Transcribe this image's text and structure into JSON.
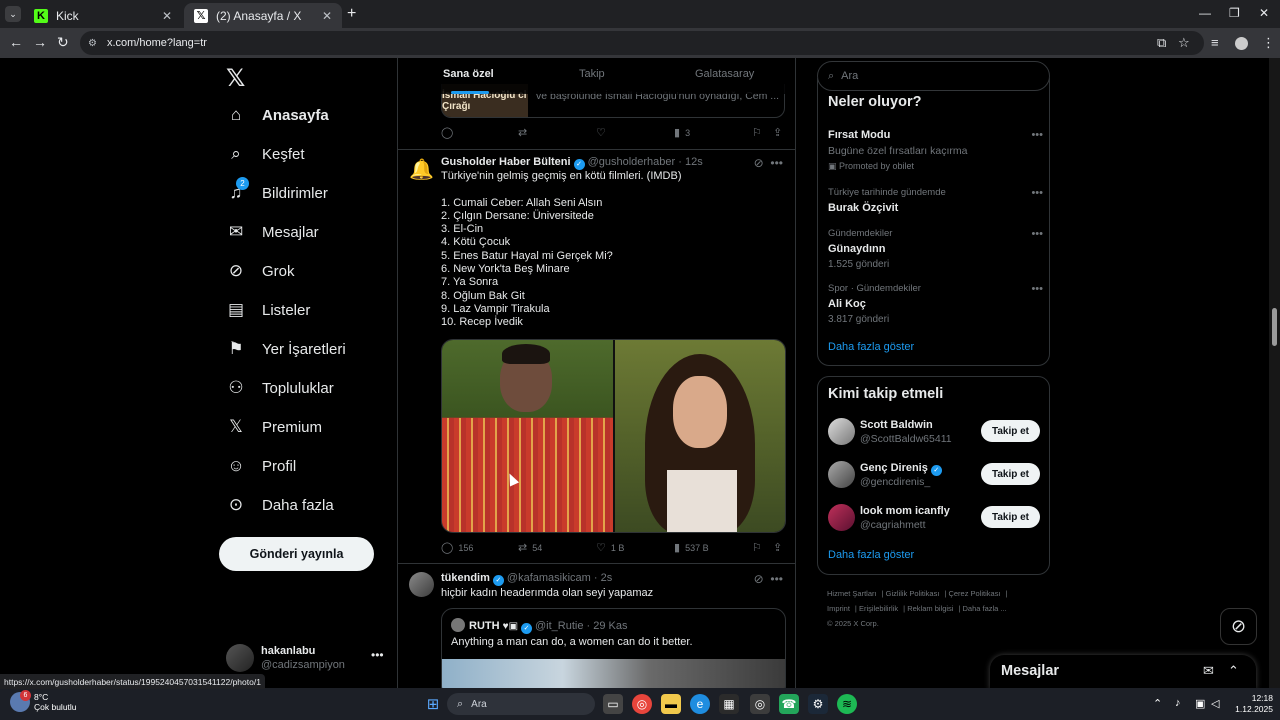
{
  "browser": {
    "tabs": [
      {
        "title": "Kick",
        "favicon": "K",
        "color": "#53fc18"
      },
      {
        "title": "(2) Anasayfa / X",
        "favicon": "X",
        "color": "#000000"
      }
    ],
    "url": "x.com/home?lang=tr",
    "status_url": "https://x.com/gusholderhaber/status/1995240457031541122/photo/1"
  },
  "nav": {
    "items": [
      {
        "label": "Anasayfa",
        "icon": "home-icon"
      },
      {
        "label": "Keşfet",
        "icon": "search-icon"
      },
      {
        "label": "Bildirimler",
        "icon": "bell-icon",
        "badge": "2"
      },
      {
        "label": "Mesajlar",
        "icon": "mail-icon"
      },
      {
        "label": "Grok",
        "icon": "grok-icon"
      },
      {
        "label": "Listeler",
        "icon": "list-icon"
      },
      {
        "label": "Yer İşaretleri",
        "icon": "bookmark-icon"
      },
      {
        "label": "Topluluklar",
        "icon": "communities-icon"
      },
      {
        "label": "Premium",
        "icon": "x-premium-icon"
      },
      {
        "label": "Profil",
        "icon": "profile-icon"
      },
      {
        "label": "Daha fazla",
        "icon": "more-circle-icon"
      }
    ],
    "post_button": "Gönderi yayınla",
    "account": {
      "name": "hakanlabu",
      "handle": "@cadizsampiyon"
    }
  },
  "feed": {
    "tabs": [
      "Sana özel",
      "Takip",
      "Galatasaray"
    ],
    "prev_tweet": {
      "quote_thumb": "İsmail Hacıoğlu ci Çırağı",
      "quote_text": "ve başrolünde İsmail Hacıoğlu'nun oynadığı, Cem ...",
      "views": "3"
    },
    "tweet1": {
      "name": "Gusholder Haber Bülteni",
      "handle": "@gusholderhaber",
      "time": "· 12s",
      "text": "Türkiye'nin gelmiş geçmiş en kötü filmleri. (IMDB)\n\n1. Cumali Ceber: Allah Seni Alsın\n2. Çılgın Dersane: Üniversitede\n3. El-Cin\n4. Kötü Çocuk\n5. Enes Batur Hayal mi Gerçek Mi?\n6. New York'ta Beş Minare\n7. Ya Sonra\n8. Oğlum Bak Git\n9. Laz Vampir Tirakula\n10. Recep İvedik",
      "replies": "156",
      "reposts": "54",
      "likes": "1 B",
      "views": "537 B"
    },
    "tweet2": {
      "name": "tükendim",
      "handle": "@kafamasikicam",
      "time": "· 2s",
      "text": "hiçbir kadın headerımda olan seyi yapamaz",
      "quote": {
        "name": "RUTH",
        "handle": "@it_Rutie",
        "time": "· 29 Kas",
        "text": "Anything a man can do, a women can do it better."
      }
    }
  },
  "sidebar": {
    "search_placeholder": "Ara",
    "trends_title": "Neler oluyor?",
    "trends": [
      {
        "meta": "",
        "title": "Fırsat Modu",
        "sub": "Bugüne özel fırsatları kaçırma",
        "promo": "Promoted by obilet"
      },
      {
        "meta": "Türkiye tarihinde gündemde",
        "title": "Burak Özçivit",
        "sub": ""
      },
      {
        "meta": "Gündemdekiler",
        "title": "Günaydınn",
        "sub": "1.525 gönderi"
      },
      {
        "meta": "Spor · Gündemdekiler",
        "title": "Ali Koç",
        "sub": "3.817 gönderi"
      }
    ],
    "show_more": "Daha fazla göster",
    "who_to_follow_title": "Kimi takip etmeli",
    "who_to_follow": [
      {
        "name": "Scott Baldwin",
        "handle": "@ScottBaldw65411",
        "button": "Takip et",
        "verified": false
      },
      {
        "name": "Genç Direniş",
        "handle": "@gencdirenis_",
        "button": "Takip et",
        "verified": true
      },
      {
        "name": "look mom icanfly",
        "handle": "@cagriahmett",
        "button": "Takip et",
        "verified": false
      }
    ],
    "footer": [
      "Hizmet Şartları",
      "Gizlilik Politikası",
      "Çerez Politikası",
      "Imprint",
      "Erişilebilirlik",
      "Reklam bilgisi",
      "Daha fazla ...",
      "© 2025 X Corp."
    ]
  },
  "messages_drawer": {
    "title": "Mesajlar"
  },
  "taskbar": {
    "weather_temp": "8°C",
    "weather_desc": "Çok bulutlu",
    "weather_badge": "6",
    "search_placeholder": "Ara",
    "time": "12:18",
    "date": "1.12.2025"
  }
}
